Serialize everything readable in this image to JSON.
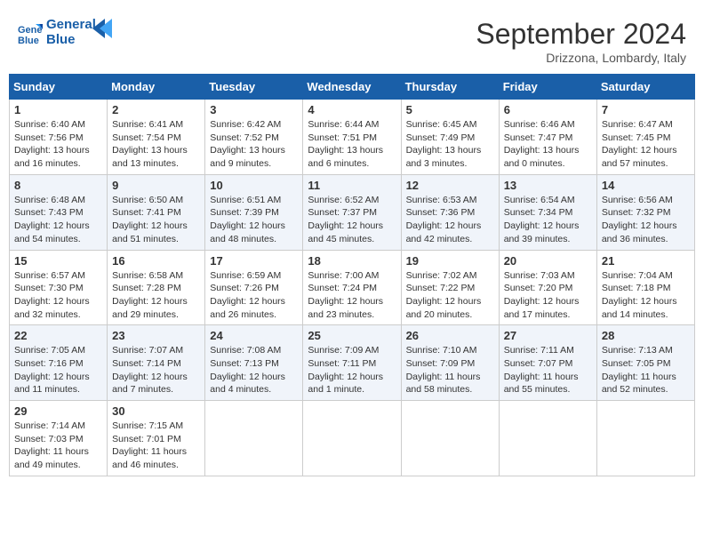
{
  "header": {
    "logo_line1": "General",
    "logo_line2": "Blue",
    "month_year": "September 2024",
    "location": "Drizzona, Lombardy, Italy"
  },
  "days_of_week": [
    "Sunday",
    "Monday",
    "Tuesday",
    "Wednesday",
    "Thursday",
    "Friday",
    "Saturday"
  ],
  "weeks": [
    [
      {
        "day": 1,
        "sunrise": "6:40 AM",
        "sunset": "7:56 PM",
        "daylight": "13 hours and 16 minutes."
      },
      {
        "day": 2,
        "sunrise": "6:41 AM",
        "sunset": "7:54 PM",
        "daylight": "13 hours and 13 minutes."
      },
      {
        "day": 3,
        "sunrise": "6:42 AM",
        "sunset": "7:52 PM",
        "daylight": "13 hours and 9 minutes."
      },
      {
        "day": 4,
        "sunrise": "6:44 AM",
        "sunset": "7:51 PM",
        "daylight": "13 hours and 6 minutes."
      },
      {
        "day": 5,
        "sunrise": "6:45 AM",
        "sunset": "7:49 PM",
        "daylight": "13 hours and 3 minutes."
      },
      {
        "day": 6,
        "sunrise": "6:46 AM",
        "sunset": "7:47 PM",
        "daylight": "13 hours and 0 minutes."
      },
      {
        "day": 7,
        "sunrise": "6:47 AM",
        "sunset": "7:45 PM",
        "daylight": "12 hours and 57 minutes."
      }
    ],
    [
      {
        "day": 8,
        "sunrise": "6:48 AM",
        "sunset": "7:43 PM",
        "daylight": "12 hours and 54 minutes."
      },
      {
        "day": 9,
        "sunrise": "6:50 AM",
        "sunset": "7:41 PM",
        "daylight": "12 hours and 51 minutes."
      },
      {
        "day": 10,
        "sunrise": "6:51 AM",
        "sunset": "7:39 PM",
        "daylight": "12 hours and 48 minutes."
      },
      {
        "day": 11,
        "sunrise": "6:52 AM",
        "sunset": "7:37 PM",
        "daylight": "12 hours and 45 minutes."
      },
      {
        "day": 12,
        "sunrise": "6:53 AM",
        "sunset": "7:36 PM",
        "daylight": "12 hours and 42 minutes."
      },
      {
        "day": 13,
        "sunrise": "6:54 AM",
        "sunset": "7:34 PM",
        "daylight": "12 hours and 39 minutes."
      },
      {
        "day": 14,
        "sunrise": "6:56 AM",
        "sunset": "7:32 PM",
        "daylight": "12 hours and 36 minutes."
      }
    ],
    [
      {
        "day": 15,
        "sunrise": "6:57 AM",
        "sunset": "7:30 PM",
        "daylight": "12 hours and 32 minutes."
      },
      {
        "day": 16,
        "sunrise": "6:58 AM",
        "sunset": "7:28 PM",
        "daylight": "12 hours and 29 minutes."
      },
      {
        "day": 17,
        "sunrise": "6:59 AM",
        "sunset": "7:26 PM",
        "daylight": "12 hours and 26 minutes."
      },
      {
        "day": 18,
        "sunrise": "7:00 AM",
        "sunset": "7:24 PM",
        "daylight": "12 hours and 23 minutes."
      },
      {
        "day": 19,
        "sunrise": "7:02 AM",
        "sunset": "7:22 PM",
        "daylight": "12 hours and 20 minutes."
      },
      {
        "day": 20,
        "sunrise": "7:03 AM",
        "sunset": "7:20 PM",
        "daylight": "12 hours and 17 minutes."
      },
      {
        "day": 21,
        "sunrise": "7:04 AM",
        "sunset": "7:18 PM",
        "daylight": "12 hours and 14 minutes."
      }
    ],
    [
      {
        "day": 22,
        "sunrise": "7:05 AM",
        "sunset": "7:16 PM",
        "daylight": "12 hours and 11 minutes."
      },
      {
        "day": 23,
        "sunrise": "7:07 AM",
        "sunset": "7:14 PM",
        "daylight": "12 hours and 7 minutes."
      },
      {
        "day": 24,
        "sunrise": "7:08 AM",
        "sunset": "7:13 PM",
        "daylight": "12 hours and 4 minutes."
      },
      {
        "day": 25,
        "sunrise": "7:09 AM",
        "sunset": "7:11 PM",
        "daylight": "12 hours and 1 minute."
      },
      {
        "day": 26,
        "sunrise": "7:10 AM",
        "sunset": "7:09 PM",
        "daylight": "11 hours and 58 minutes."
      },
      {
        "day": 27,
        "sunrise": "7:11 AM",
        "sunset": "7:07 PM",
        "daylight": "11 hours and 55 minutes."
      },
      {
        "day": 28,
        "sunrise": "7:13 AM",
        "sunset": "7:05 PM",
        "daylight": "11 hours and 52 minutes."
      }
    ],
    [
      {
        "day": 29,
        "sunrise": "7:14 AM",
        "sunset": "7:03 PM",
        "daylight": "11 hours and 49 minutes."
      },
      {
        "day": 30,
        "sunrise": "7:15 AM",
        "sunset": "7:01 PM",
        "daylight": "11 hours and 46 minutes."
      },
      null,
      null,
      null,
      null,
      null
    ]
  ]
}
